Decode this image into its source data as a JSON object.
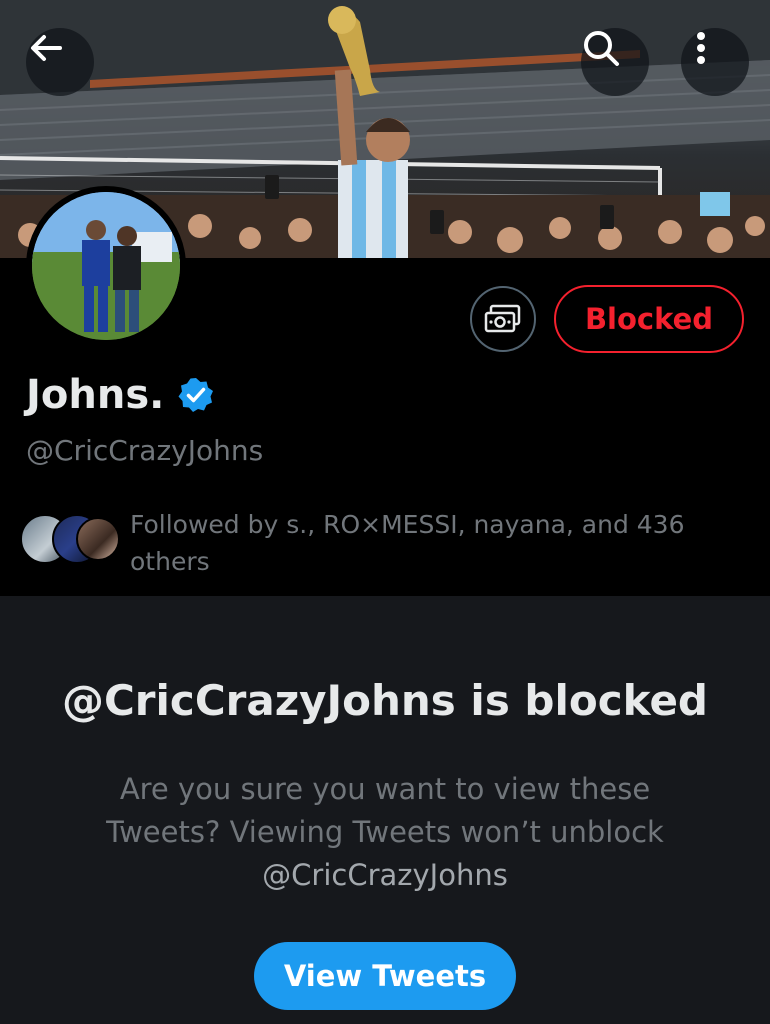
{
  "header": {
    "back_icon": "arrow-left-icon",
    "search_icon": "search-icon",
    "more_icon": "more-vertical-icon"
  },
  "profile": {
    "name": "Johns.",
    "verified": true,
    "handle": "@CricCrazyJohns",
    "blocked_label": "Blocked",
    "pay_icon": "money-icon",
    "followed_by": "Followed by s., RO×MESSI, nayana, and 436 others"
  },
  "blocked_notice": {
    "title": "@CricCrazyJohns is blocked",
    "message": "Are you sure you want to view these Tweets? Viewing Tweets won’t unblock",
    "handle": "@CricCrazyJohns",
    "button_label": "View Tweets"
  },
  "colors": {
    "accent": "#1d9bf0",
    "danger": "#f4212e",
    "background": "#000000",
    "panel": "#16181c",
    "muted_text": "#71767b"
  }
}
